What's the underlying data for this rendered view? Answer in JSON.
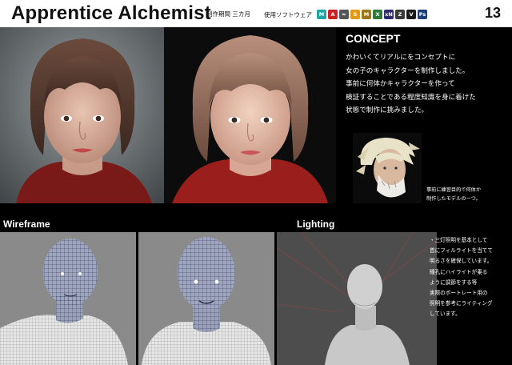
{
  "header": {
    "title": "Apprentice Alchemist",
    "period": "制作期間 三カ月",
    "software_label": "使用ソフトウェア",
    "software_icons": [
      {
        "name": "maya-icon",
        "glyph": "M",
        "color": "#1fa7a8"
      },
      {
        "name": "arnold-icon",
        "glyph": "A",
        "color": "#cc2222"
      },
      {
        "name": "marvelous-icon",
        "glyph": "≈",
        "color": "#555555"
      },
      {
        "name": "substance-icon",
        "glyph": "S",
        "color": "#e59a14"
      },
      {
        "name": "mari-icon",
        "glyph": "M",
        "color": "#9a7a18"
      },
      {
        "name": "xgen-icon",
        "glyph": "X",
        "color": "#2f7a3a"
      },
      {
        "name": "xnormal-icon",
        "glyph": "xN",
        "color": "#2c2c6e"
      },
      {
        "name": "zbrush-icon",
        "glyph": "Z",
        "color": "#3a3a3a"
      },
      {
        "name": "vray-icon",
        "glyph": "V",
        "color": "#1a1a1a"
      },
      {
        "name": "photoshop-icon",
        "glyph": "Ps",
        "color": "#1c3f7a"
      }
    ],
    "page_number": "13"
  },
  "concept": {
    "heading": "CONCEPT",
    "lines": [
      "かわいくてリアルにをコンセプトに",
      "女の子のキャラクターを制作しました。",
      "事前に何体かキャラクターを作って",
      "検証することである程度知識を身に着けた",
      "状態で制作に挑みました。"
    ]
  },
  "prior_model": {
    "caption_lines": [
      "事前に練習目的で何体か",
      "制作したモデルの一つ。"
    ]
  },
  "sections": {
    "wireframe": "Wireframe",
    "lighting": "Lighting"
  },
  "lighting_notes": {
    "lines": [
      "・三灯照明を基本として",
      "首にフィルライトを当てて",
      "明るさを確保しています。",
      "瞳孔にハイライトが乗る",
      "ように調節をする等",
      "実際のポートレート用の",
      "照明を参考にライティング",
      "しています。"
    ]
  }
}
